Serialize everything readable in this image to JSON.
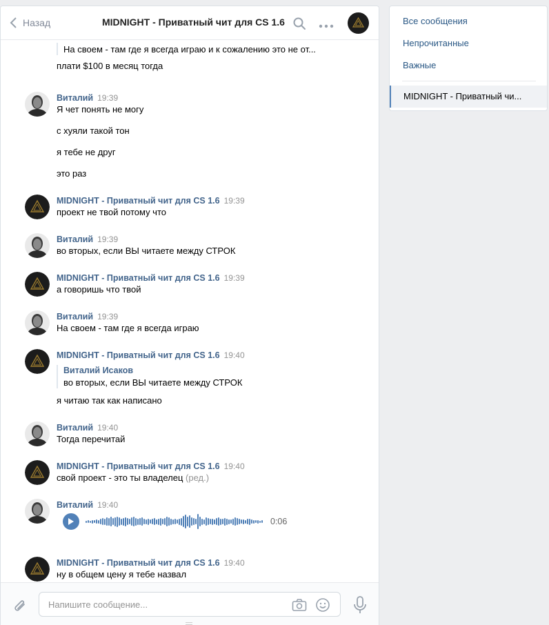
{
  "header": {
    "back_label": "Назад",
    "title": "MIDNIGHT - Приватный чит для CS 1.6"
  },
  "messages": {
    "m0_quote_text": "На своем - там где я всегда играю и к сожалению это не от...",
    "m0_text": "плати $100 в месяц тогда",
    "m1_author": "Виталий",
    "m1_time": "19:39",
    "m1_lines": [
      "Я чет понять не могу",
      "с хуяли такой тон",
      "я тебе не друг",
      "это раз"
    ],
    "m2_author": "MIDNIGHT - Приватный чит для CS 1.6",
    "m2_time": "19:39",
    "m2_text": "проект не твой потому что",
    "m3_author": "Виталий",
    "m3_time": "19:39",
    "m3_text": "во вторых, если ВЫ читаете между СТРОК",
    "m4_author": "MIDNIGHT - Приватный чит для CS 1.6",
    "m4_time": "19:39",
    "m4_text": "а говоришь что твой",
    "m5_author": "Виталий",
    "m5_time": "19:39",
    "m5_text": "На своем - там где я всегда играю",
    "m6_author": "MIDNIGHT - Приватный чит для CS 1.6",
    "m6_time": "19:40",
    "m6_quote_author": "Виталий Исаков",
    "m6_quote_text": "во вторых, если ВЫ читаете между СТРОК",
    "m6_text": "я читаю так как написано",
    "m7_author": "Виталий",
    "m7_time": "19:40",
    "m7_text": "Тогда перечитай",
    "m8_author": "MIDNIGHT - Приватный чит для CS 1.6",
    "m8_time": "19:40",
    "m8_text": "свой проект - это ты владелец",
    "m8_edited": "(ред.)",
    "m9_author": "Виталий",
    "m9_time": "19:40",
    "m9_audio_duration": "0:06",
    "m10_author": "MIDNIGHT - Приватный чит для CS 1.6",
    "m10_time": "19:40",
    "m10_text": "ну в общем цену я тебе назвал"
  },
  "composer": {
    "placeholder": "Напишите сообщение..."
  },
  "sidebar": {
    "items": [
      "Все сообщения",
      "Непрочитанные",
      "Важные"
    ],
    "active_chat": "MIDNIGHT - Приватный чи..."
  },
  "colors": {
    "link": "#2a5885",
    "author": "#42648b",
    "accent": "#5181b8",
    "muted": "#939393"
  }
}
